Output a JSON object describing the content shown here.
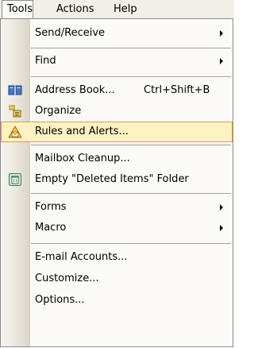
{
  "menubar": {
    "items": [
      {
        "label": "Tools"
      },
      {
        "label": "Actions"
      },
      {
        "label": "Help"
      }
    ]
  },
  "menu": {
    "items": [
      {
        "label": "Send/Receive",
        "submenu": true
      },
      {
        "label": "Find",
        "submenu": true
      },
      {
        "label": "Address Book...",
        "shortcut": "Ctrl+Shift+B",
        "icon": "address-book-icon"
      },
      {
        "label": "Organize",
        "icon": "organize-icon"
      },
      {
        "label": "Rules and Alerts...",
        "icon": "rules-alerts-icon",
        "highlighted": true
      },
      {
        "label": "Mailbox Cleanup..."
      },
      {
        "label": "Empty \"Deleted Items\" Folder",
        "icon": "deleted-items-icon"
      },
      {
        "label": "Forms",
        "submenu": true
      },
      {
        "label": "Macro",
        "submenu": true
      },
      {
        "label": "E-mail Accounts..."
      },
      {
        "label": "Customize..."
      },
      {
        "label": "Options..."
      }
    ]
  },
  "colors": {
    "highlight_fill": "#fff2c2",
    "highlight_border": "#d8a436",
    "menu_background": "#fbfaf6"
  }
}
